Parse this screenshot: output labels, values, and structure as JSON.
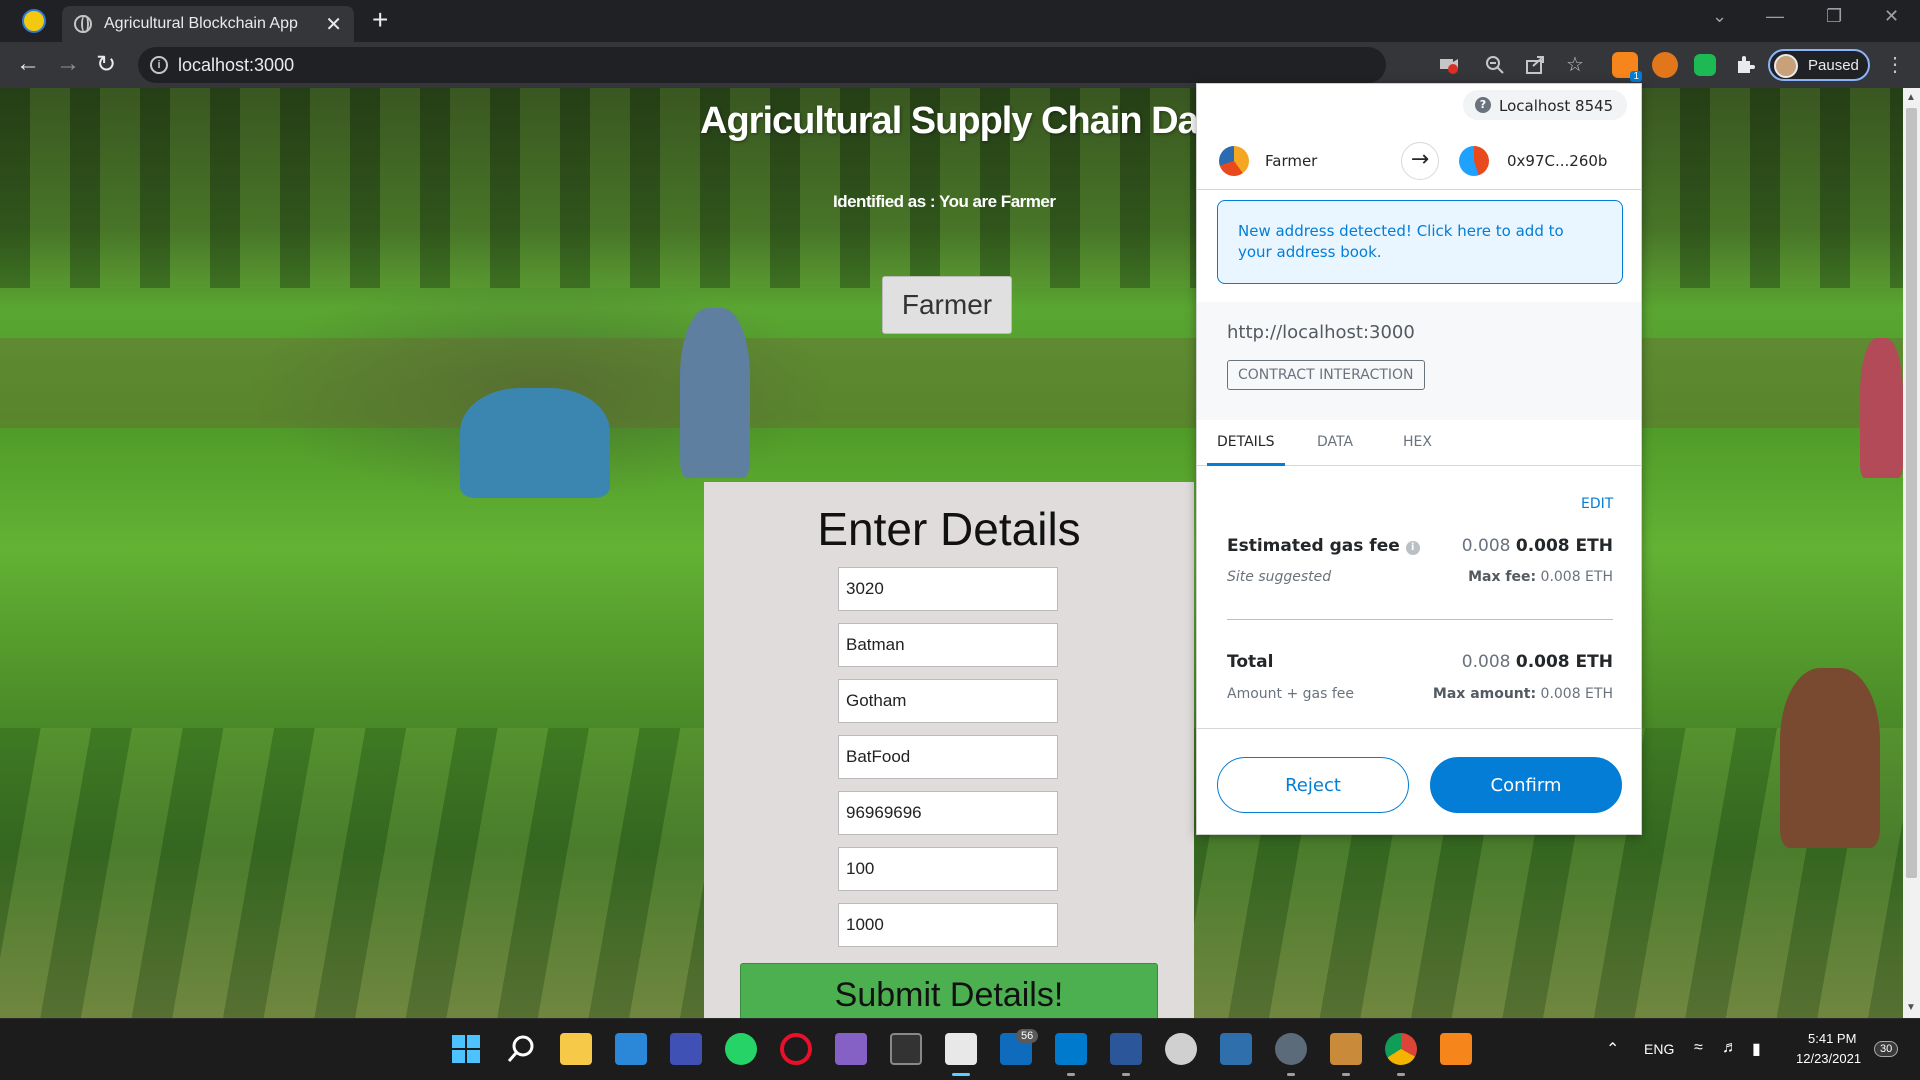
{
  "browser": {
    "tab_title": "Agricultural Blockchain App",
    "tab_close": "✕",
    "new_tab": "+",
    "url": "localhost:3000",
    "profile_label": "Paused",
    "ext_badge": "1"
  },
  "app": {
    "title": "Agricultural Supply Chain Dapp",
    "identified": "Identified as : You are Farmer",
    "role_button": "Farmer",
    "form": {
      "title": "Enter Details",
      "fields": [
        "3020",
        "Batman",
        "Gotham",
        "BatFood",
        "96969696",
        "100",
        "1000"
      ],
      "submit": "Submit Details!"
    }
  },
  "metamask": {
    "network": "Localhost 8545",
    "from_account": "Farmer",
    "to_address": "0x97C...260b",
    "notice": "New address detected! Click here to add to your address book.",
    "origin": "http://localhost:3000",
    "contract_label": "CONTRACT INTERACTION",
    "tabs": [
      "DETAILS",
      "DATA",
      "HEX"
    ],
    "edit": "EDIT",
    "gas": {
      "label": "Estimated gas fee",
      "value_light": "0.008",
      "value_bold": "0.008 ETH",
      "sub": "Site suggested",
      "max_label": "Max fee:",
      "max_value": "0.008 ETH"
    },
    "total": {
      "label": "Total",
      "value_light": "0.008",
      "value_bold": "0.008 ETH",
      "sub": "Amount + gas fee",
      "max_label": "Max amount:",
      "max_value": "0.008 ETH"
    },
    "reject": "Reject",
    "confirm": "Confirm",
    "colors": {
      "primary": "#037dd6"
    }
  },
  "taskbar": {
    "badge_mail": "56",
    "lang": "ENG",
    "time": "5:41 PM",
    "date": "12/23/2021",
    "notif_count": "30"
  }
}
